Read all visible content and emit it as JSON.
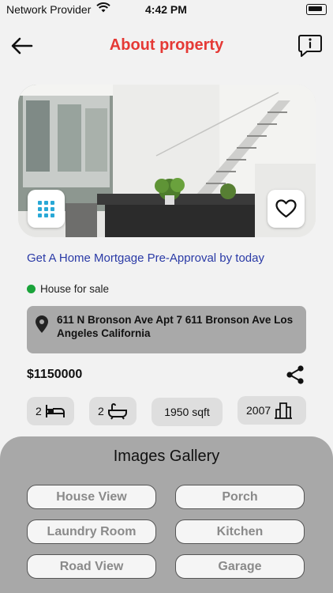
{
  "status_bar": {
    "carrier": "Network Provider",
    "time": "4:42 PM"
  },
  "nav": {
    "title": "About property",
    "back_icon": "arrow-left-icon",
    "message_icon": "info-message-icon"
  },
  "hero": {
    "grid_icon": "grid-icon",
    "favorite_icon": "heart-icon"
  },
  "mortgage_link": "Get A Home Mortgage Pre-Approval by today",
  "status": {
    "label": "House for sale",
    "color": "#1aa33a"
  },
  "address": "611 N Bronson Ave Apt 7 611 Bronson Ave Los Angeles California",
  "price": "$1150000",
  "features": {
    "beds": "2",
    "baths": "2",
    "sqft": "1950 sqft",
    "year": "2007"
  },
  "gallery": {
    "title": "Images Gallery",
    "items": [
      "House View",
      "Porch",
      "Laundry Room",
      "Kitchen",
      "Road View",
      "Garage"
    ]
  },
  "colors": {
    "title": "#e53935",
    "link": "#2a3aa6",
    "grid_icon": "#29a8d6",
    "gallery_bg": "#a8a8a8"
  }
}
